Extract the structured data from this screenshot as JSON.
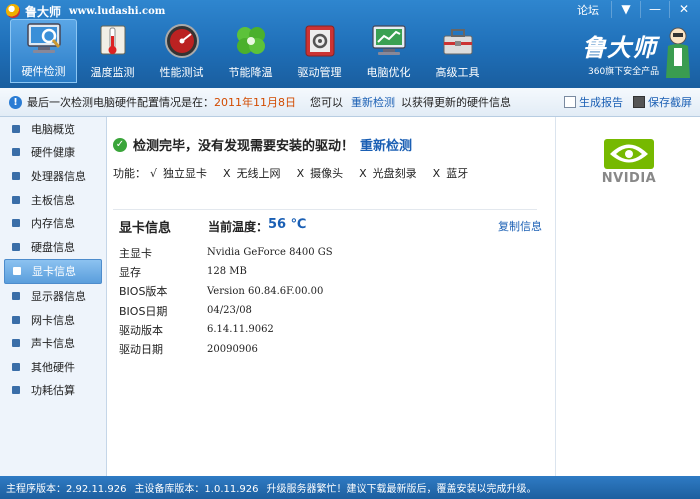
{
  "app": {
    "title": "鲁大师",
    "url": "www.ludashi.com",
    "forum": "论坛"
  },
  "window_buttons": {
    "menu": "▼",
    "minimize": "—",
    "close": "✕"
  },
  "tools": [
    {
      "label": "硬件检测",
      "active": true
    },
    {
      "label": "温度监测"
    },
    {
      "label": "性能测试"
    },
    {
      "label": "节能降温"
    },
    {
      "label": "驱动管理"
    },
    {
      "label": "电脑优化"
    },
    {
      "label": "高级工具"
    }
  ],
  "brand": {
    "logo_text": "鲁大师",
    "subtitle": "360旗下安全产品"
  },
  "infobar": {
    "prefix": "最后一次检测电脑硬件配置情况是在：",
    "date": "2011年11月8日",
    "mid": "您可以",
    "link": "重新检测",
    "suffix": "以获得更新的硬件信息",
    "report": "生成报告",
    "screenshot": "保存截屏"
  },
  "sidebar": [
    {
      "label": "电脑概览"
    },
    {
      "label": "硬件健康"
    },
    {
      "label": "处理器信息"
    },
    {
      "label": "主板信息"
    },
    {
      "label": "内存信息"
    },
    {
      "label": "硬盘信息"
    },
    {
      "label": "显卡信息",
      "active": true
    },
    {
      "label": "显示器信息"
    },
    {
      "label": "网卡信息"
    },
    {
      "label": "声卡信息"
    },
    {
      "label": "其他硬件"
    },
    {
      "label": "功耗估算"
    }
  ],
  "main": {
    "status_text": "检测完毕，没有发现需要安装的驱动！",
    "recheck": "重新检测",
    "features_label": "功能：",
    "features": [
      {
        "mark": "√",
        "label": "独立显卡"
      },
      {
        "mark": "X",
        "label": "无线上网"
      },
      {
        "mark": "X",
        "label": "摄像头"
      },
      {
        "mark": "X",
        "label": "光盘刻录"
      },
      {
        "mark": "X",
        "label": "蓝牙"
      }
    ],
    "section_title": "显卡信息",
    "temp_label": "当前温度：",
    "temp_value": "56 ℃",
    "copy": "复制信息",
    "rows": [
      {
        "key": "主显卡",
        "value": "Nvidia GeForce 8400 GS"
      },
      {
        "key": "显存",
        "value": "128 MB"
      },
      {
        "key": "BIOS版本",
        "value": "Version 60.84.6F.00.00"
      },
      {
        "key": "BIOS日期",
        "value": "04/23/08"
      },
      {
        "key": "驱动版本",
        "value": "6.14.11.9062"
      },
      {
        "key": "驱动日期",
        "value": "20090906"
      }
    ]
  },
  "vendor_logo": "NVIDIA",
  "statusbar": {
    "main_version": "主程序版本：2.92.11.926",
    "db_version": "主设备库版本：1.0.11.926",
    "notice": "升级服务器繁忙！建议下载最新版后，覆盖安装以完成升级。"
  },
  "colors": {
    "accent": "#1f6fb8",
    "link": "#1a5fb4",
    "date": "#d24b00",
    "ok": "#3aa53a",
    "nvidia_green": "#76b900"
  }
}
